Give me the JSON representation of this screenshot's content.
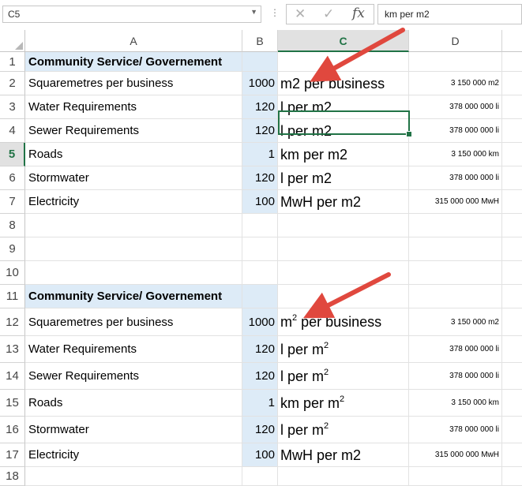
{
  "formula_bar": {
    "name_box": "C5",
    "cancel_icon": "✕",
    "enter_icon": "✓",
    "fx_label": "fx",
    "formula_value": "km per m2"
  },
  "columns": [
    "A",
    "B",
    "C",
    "D"
  ],
  "selected_cell": "C5",
  "rows": [
    {
      "num": "1",
      "a": "Community Service/ Governement",
      "b": "",
      "c": "",
      "c_sup": "",
      "c_rest": "",
      "d": "",
      "header": true
    },
    {
      "num": "2",
      "a": "Squaremetres per business",
      "b": "1000",
      "c": "m2 per business",
      "c_sup": "",
      "c_rest": "",
      "d": "3 150 000 m2"
    },
    {
      "num": "3",
      "a": "Water Requirements",
      "b": "120",
      "c": "l per m2",
      "c_sup": "",
      "c_rest": "",
      "d": "378 000 000 li"
    },
    {
      "num": "4",
      "a": "Sewer Requirements",
      "b": "120",
      "c": "l per m2",
      "c_sup": "",
      "c_rest": "",
      "d": "378 000 000 li"
    },
    {
      "num": "5",
      "a": "Roads",
      "b": "1",
      "c": "km per m2",
      "c_sup": "",
      "c_rest": "",
      "d": "3 150 000 km"
    },
    {
      "num": "6",
      "a": "Stormwater",
      "b": "120",
      "c": "l per m2",
      "c_sup": "",
      "c_rest": "",
      "d": "378 000 000 li"
    },
    {
      "num": "7",
      "a": "Electricity",
      "b": "100",
      "c": "MwH per m2",
      "c_sup": "",
      "c_rest": "",
      "d": "315 000 000 MwH"
    },
    {
      "num": "8",
      "a": "",
      "b": "",
      "c": "",
      "c_sup": "",
      "c_rest": "",
      "d": ""
    },
    {
      "num": "9",
      "a": "",
      "b": "",
      "c": "",
      "c_sup": "",
      "c_rest": "",
      "d": ""
    },
    {
      "num": "10",
      "a": "",
      "b": "",
      "c": "",
      "c_sup": "",
      "c_rest": "",
      "d": ""
    },
    {
      "num": "11",
      "a": "Community Service/ Governement",
      "b": "",
      "c": "",
      "c_sup": "",
      "c_rest": "",
      "d": "",
      "header": true
    },
    {
      "num": "12",
      "a": "Squaremetres per business",
      "b": "1000",
      "c": "m",
      "c_sup": "2",
      "c_rest": " per business",
      "d": "3 150 000 m2"
    },
    {
      "num": "13",
      "a": "Water Requirements",
      "b": "120",
      "c": "l per m",
      "c_sup": "2",
      "c_rest": "",
      "d": "378 000 000 li"
    },
    {
      "num": "14",
      "a": "Sewer Requirements",
      "b": "120",
      "c": "l per m",
      "c_sup": "2",
      "c_rest": "",
      "d": "378 000 000 li"
    },
    {
      "num": "15",
      "a": "Roads",
      "b": "1",
      "c": "km per m",
      "c_sup": "2",
      "c_rest": "",
      "d": "3 150 000 km"
    },
    {
      "num": "16",
      "a": "Stormwater",
      "b": "120",
      "c": "l per m",
      "c_sup": "2",
      "c_rest": "",
      "d": "378 000 000 li"
    },
    {
      "num": "17",
      "a": "Electricity",
      "b": "100",
      "c": "MwH per m2",
      "c_sup": "",
      "c_rest": "",
      "d": "315 000 000 MwH"
    },
    {
      "num": "18",
      "a": "",
      "b": "",
      "c": "",
      "c_sup": "",
      "c_rest": "",
      "d": ""
    }
  ],
  "colors": {
    "accent_green": "#217346",
    "cell_fill_blue": "#ddebf7",
    "arrow_red": "#e0483e"
  }
}
